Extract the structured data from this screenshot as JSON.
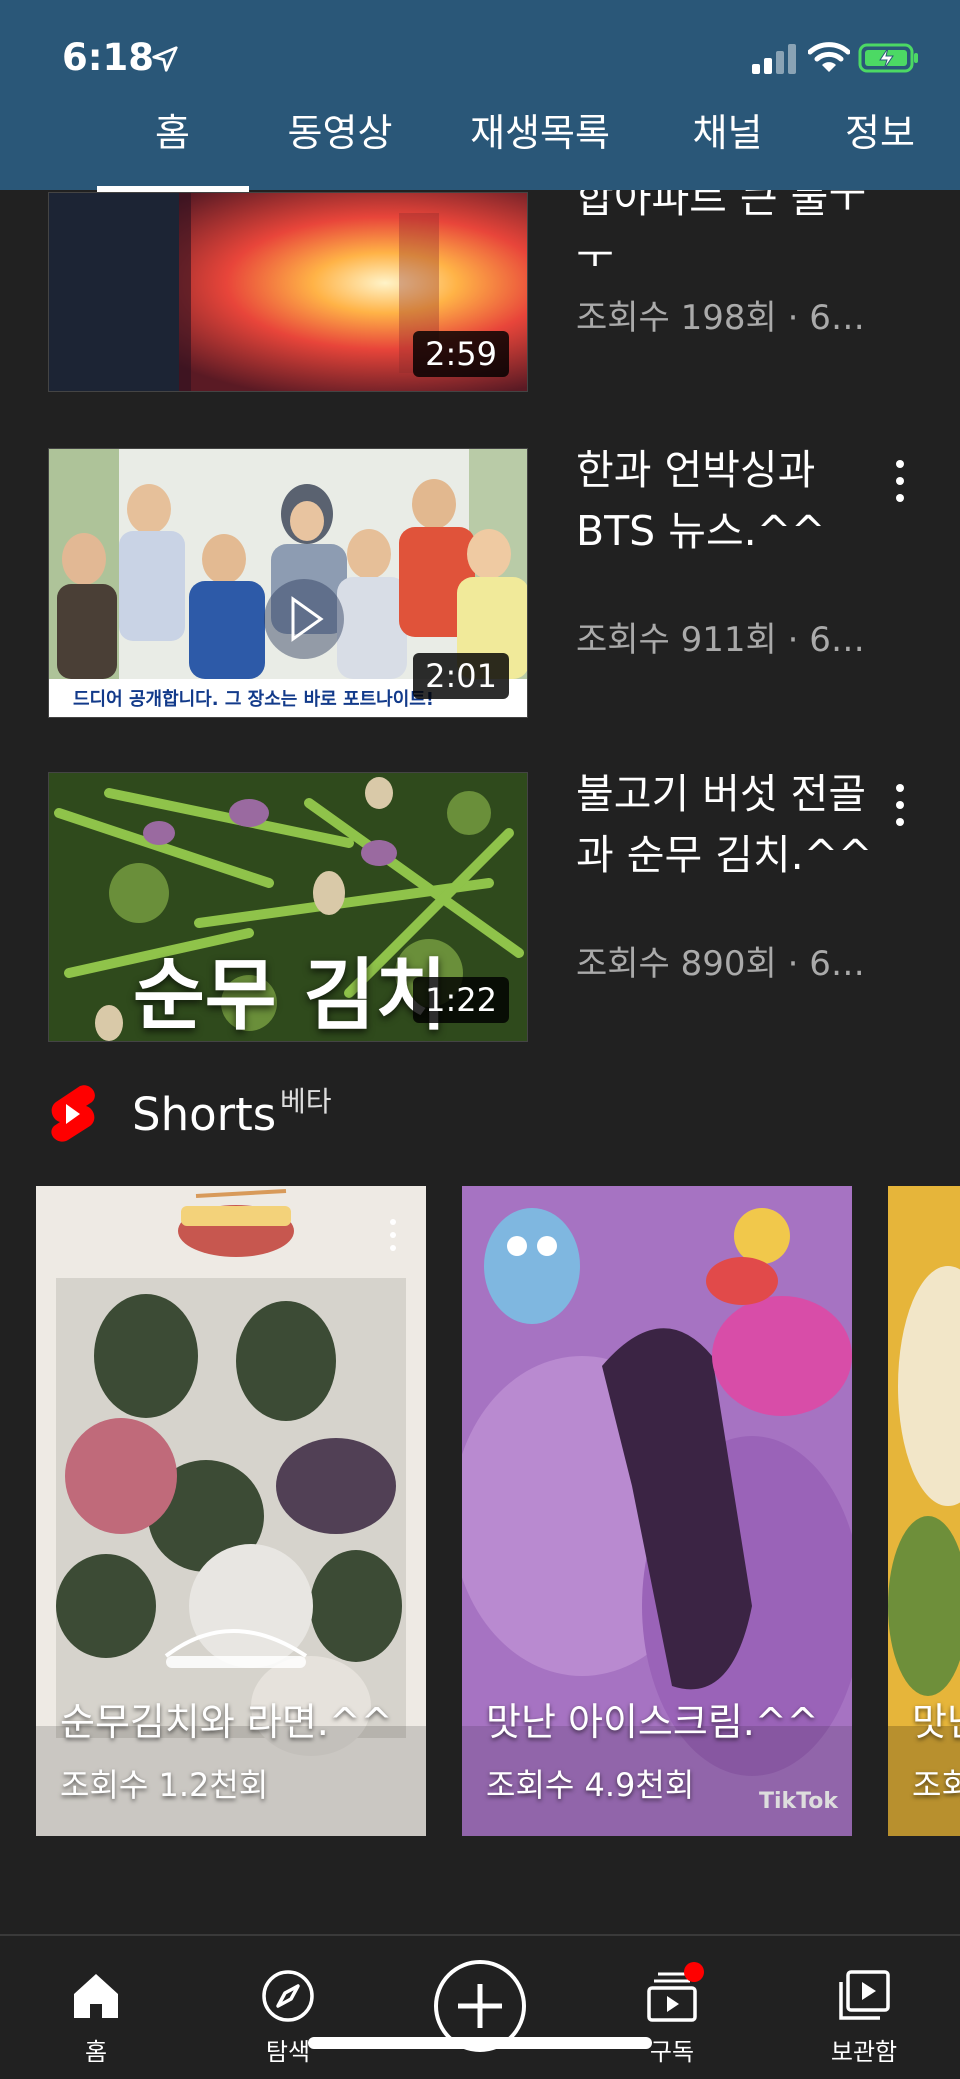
{
  "status_bar": {
    "time": "6:18"
  },
  "tabs": [
    {
      "label": "홈"
    },
    {
      "label": "동영상"
    },
    {
      "label": "재생목록"
    },
    {
      "label": "채널"
    },
    {
      "label": "정보"
    }
  ],
  "videos": [
    {
      "title": "합아파트 큰 불ㅜㅜ",
      "meta": "조회수 198회 · 6…",
      "duration": "2:59"
    },
    {
      "title": "한과 언박싱과 BTS 뉴스.^^",
      "meta": "조회수 911회 · 6…",
      "duration": "2:01",
      "thumb_caption": "드디어 공개합니다. 그 장소는 바로 포트나이트!"
    },
    {
      "title": "불고기 버섯 전골과 순무 김치.^^",
      "meta": "조회수 890회 · 6…",
      "duration": "1:22",
      "thumb_caption": "순무 김치"
    }
  ],
  "shorts": {
    "title": "Shorts",
    "badge": "베타",
    "items": [
      {
        "title": "순무김치와 라면.^^",
        "views": "조회수 1.2천회"
      },
      {
        "title": "맛난 아이스크림.^^",
        "views": "조회수 4.9천회",
        "watermark": "TikTok"
      },
      {
        "title": "맛난",
        "views": "조회"
      }
    ]
  },
  "bottom_nav": [
    {
      "label": "홈",
      "icon": "home-icon"
    },
    {
      "label": "탐색",
      "icon": "compass-icon"
    },
    {
      "label": "",
      "icon": "create-icon"
    },
    {
      "label": "구독",
      "icon": "subscriptions-icon"
    },
    {
      "label": "보관함",
      "icon": "library-icon"
    }
  ],
  "colors": {
    "header": "#2a5778",
    "background": "#212121",
    "shorts_red": "#ff0000",
    "battery_green": "#4cd964"
  }
}
